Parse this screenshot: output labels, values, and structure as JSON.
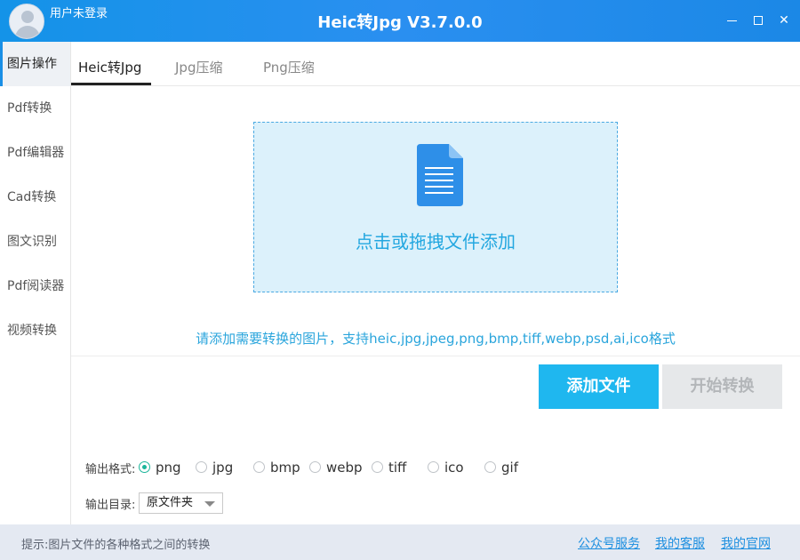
{
  "titlebar": {
    "title": "Heic转Jpg V3.7.0.0",
    "user_label": "用户未登录",
    "min_glyph": "",
    "max_glyph": "",
    "close_glyph": "✕"
  },
  "sidebar": {
    "items": [
      {
        "label": "图片操作"
      },
      {
        "label": "Pdf转换"
      },
      {
        "label": "Pdf编辑器"
      },
      {
        "label": "Cad转换"
      },
      {
        "label": "图文识别"
      },
      {
        "label": "Pdf阅读器"
      },
      {
        "label": "视频转换"
      }
    ]
  },
  "tabs": [
    {
      "label": "Heic转Jpg"
    },
    {
      "label": "Jpg压缩"
    },
    {
      "label": "Png压缩"
    }
  ],
  "dropzone": {
    "text": "点击或拖拽文件添加"
  },
  "hint": "请添加需要转换的图片，支持heic,jpg,jpeg,png,bmp,tiff,webp,psd,ai,ico格式",
  "buttons": {
    "add": "添加文件",
    "start": "开始转换"
  },
  "output": {
    "format_label": "输出格式:",
    "formats": [
      "png",
      "jpg",
      "bmp",
      "webp",
      "tiff",
      "ico",
      "gif"
    ],
    "selected_format": "png",
    "dir_label": "输出目录:",
    "dir_value": "原文件夹"
  },
  "footer": {
    "hint": "提示:图片文件的各种格式之间的转换",
    "links": [
      "公众号服务",
      "我的客服",
      "我的官网"
    ]
  },
  "colors": {
    "accent": "#1fb7ef",
    "title_bar": "#1b8de8",
    "drop_bg": "#dcf1fb",
    "footer_bg": "#e4e9f2"
  }
}
